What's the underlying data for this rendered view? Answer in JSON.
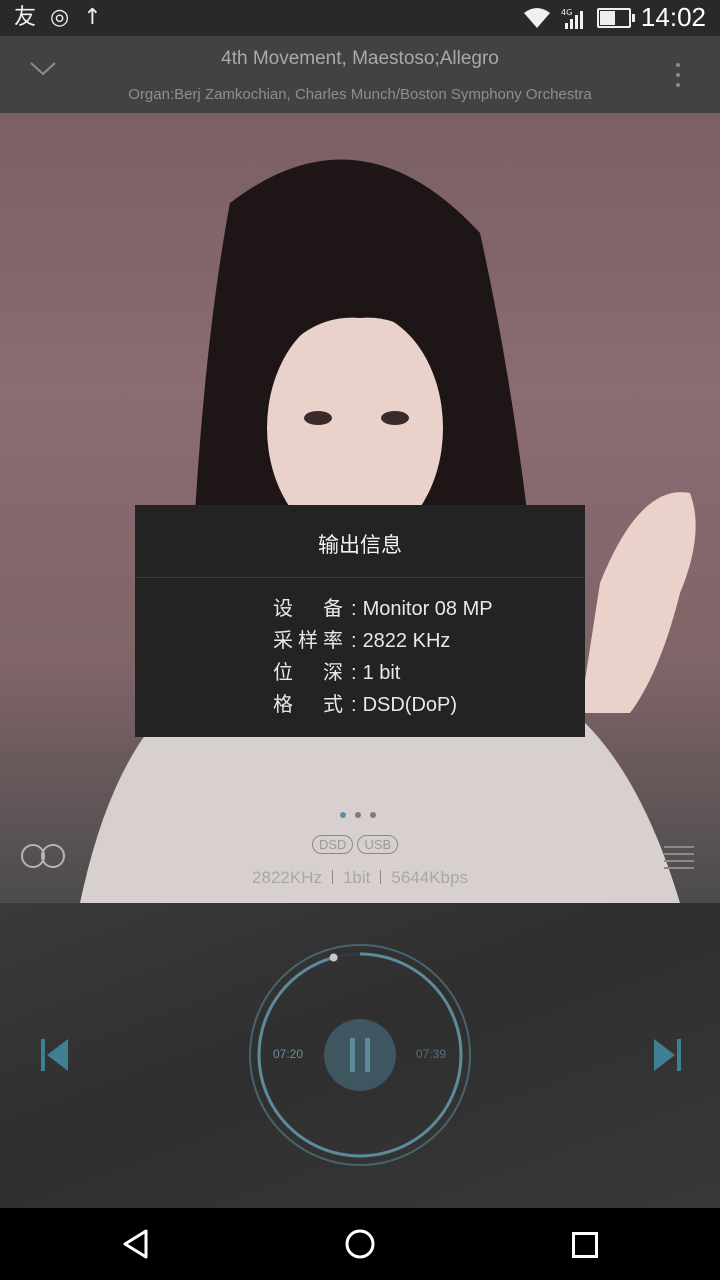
{
  "status_bar": {
    "time": "14:02",
    "network": "4G",
    "left_icons": [
      "app-icon",
      "target-icon",
      "usb-icon"
    ]
  },
  "header": {
    "title": "4th Movement, Maestoso;Allegro",
    "artist": "Organ:Berj Zamkochian, Charles Munch/Boston Symphony Orchestra"
  },
  "dialog": {
    "title": "输出信息",
    "rows": [
      {
        "key_chars": [
          "设",
          "备"
        ],
        "value": "Monitor 08 MP"
      },
      {
        "key_chars": [
          "采",
          "样",
          "率"
        ],
        "value": "2822 KHz"
      },
      {
        "key_chars": [
          "位",
          "深"
        ],
        "value": "1 bit"
      },
      {
        "key_chars": [
          "格",
          "式"
        ],
        "value": "DSD(DoP)"
      }
    ],
    "separator": ":"
  },
  "badges": [
    "DSD",
    "USB"
  ],
  "tech": {
    "rate": "2822KHz",
    "depth": "1bit",
    "bitrate": "5644Kbps"
  },
  "player": {
    "elapsed": "07:20",
    "total": "07:39",
    "progress": 0.958,
    "accent": "#5e8a9c"
  },
  "page_indicator": {
    "count": 3,
    "active": 0
  }
}
